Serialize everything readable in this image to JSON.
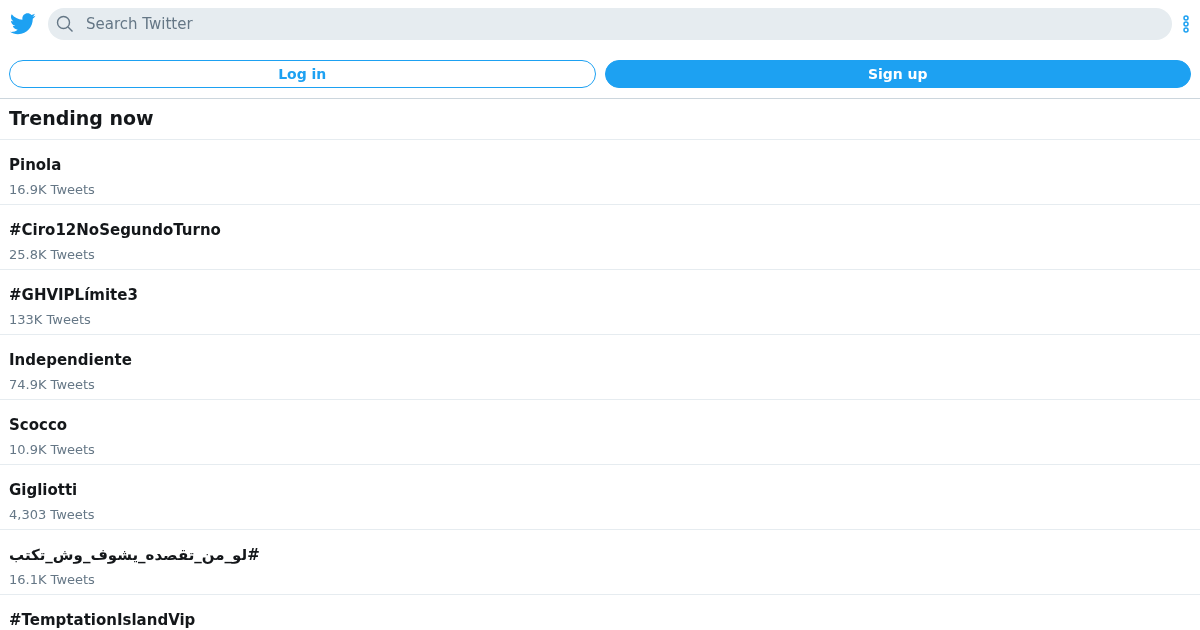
{
  "search": {
    "placeholder": "Search Twitter"
  },
  "buttons": {
    "login": "Log in",
    "signup": "Sign up"
  },
  "heading": "Trending now",
  "trends": [
    {
      "name": "Pinola",
      "count": "16.9K Tweets"
    },
    {
      "name": "#Ciro12NoSegundoTurno",
      "count": "25.8K Tweets"
    },
    {
      "name": "#GHVIPLímite3",
      "count": "133K Tweets"
    },
    {
      "name": "Independiente",
      "count": "74.9K Tweets"
    },
    {
      "name": "Scocco",
      "count": "10.9K Tweets"
    },
    {
      "name": "Gigliotti",
      "count": "4,303 Tweets"
    },
    {
      "name": "#لو_من_تقصده_يشوف_وش_تكتب",
      "count": "16.1K Tweets"
    },
    {
      "name": "#TemptationIslandVip"
    }
  ]
}
